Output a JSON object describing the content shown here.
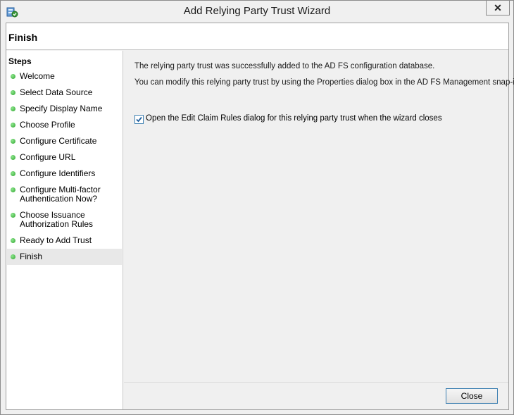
{
  "window": {
    "title": "Add Relying Party Trust Wizard",
    "close_glyph": "✕"
  },
  "header": {
    "title": "Finish"
  },
  "steps": {
    "title": "Steps",
    "items": [
      {
        "label": "Welcome"
      },
      {
        "label": "Select Data Source"
      },
      {
        "label": "Specify Display Name"
      },
      {
        "label": "Choose Profile"
      },
      {
        "label": "Configure Certificate"
      },
      {
        "label": "Configure URL"
      },
      {
        "label": "Configure Identifiers"
      },
      {
        "label": "Configure Multi-factor Authentication Now?"
      },
      {
        "label": "Choose Issuance Authorization Rules"
      },
      {
        "label": "Ready to Add Trust"
      },
      {
        "label": "Finish"
      }
    ],
    "active_index": 10
  },
  "content": {
    "message1": "The relying party trust was successfully added to the AD FS configuration database.",
    "message2": "You can modify this relying party trust by using the Properties dialog box in the AD FS Management snap-in.",
    "checkbox_label": "Open the Edit Claim Rules dialog for this relying party trust when the wizard closes",
    "checkbox_checked": true
  },
  "footer": {
    "close_label": "Close"
  },
  "colors": {
    "step_dot": "#2ea52e",
    "accent": "#3c7fb1"
  }
}
